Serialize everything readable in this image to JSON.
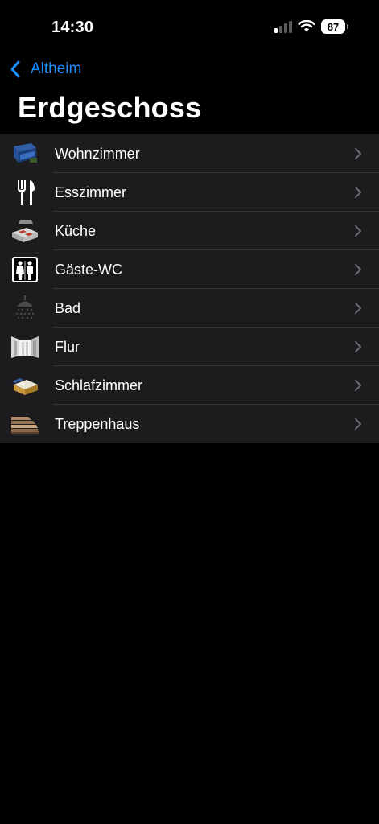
{
  "status_bar": {
    "time": "14:30",
    "battery": "87",
    "signal_icon": "cellular-signal-icon",
    "wifi_icon": "wifi-icon"
  },
  "nav": {
    "back_label": "Altheim",
    "back_icon": "chevron-left-icon",
    "title": "Erdgeschoss"
  },
  "rooms": [
    {
      "label": "Wohnzimmer",
      "icon": "sofa-icon"
    },
    {
      "label": "Esszimmer",
      "icon": "fork-knife-icon"
    },
    {
      "label": "Küche",
      "icon": "kitchen-stove-icon"
    },
    {
      "label": "Gäste-WC",
      "icon": "restroom-icon"
    },
    {
      "label": "Bad",
      "icon": "shower-icon"
    },
    {
      "label": "Flur",
      "icon": "hallway-doors-icon"
    },
    {
      "label": "Schlafzimmer",
      "icon": "bed-icon"
    },
    {
      "label": "Treppenhaus",
      "icon": "stairs-icon"
    }
  ],
  "colors": {
    "background": "#000000",
    "list_background": "#1c1c1e",
    "separator": "#38383a",
    "accent": "#1f8fff",
    "chevron": "#6b6b70"
  }
}
